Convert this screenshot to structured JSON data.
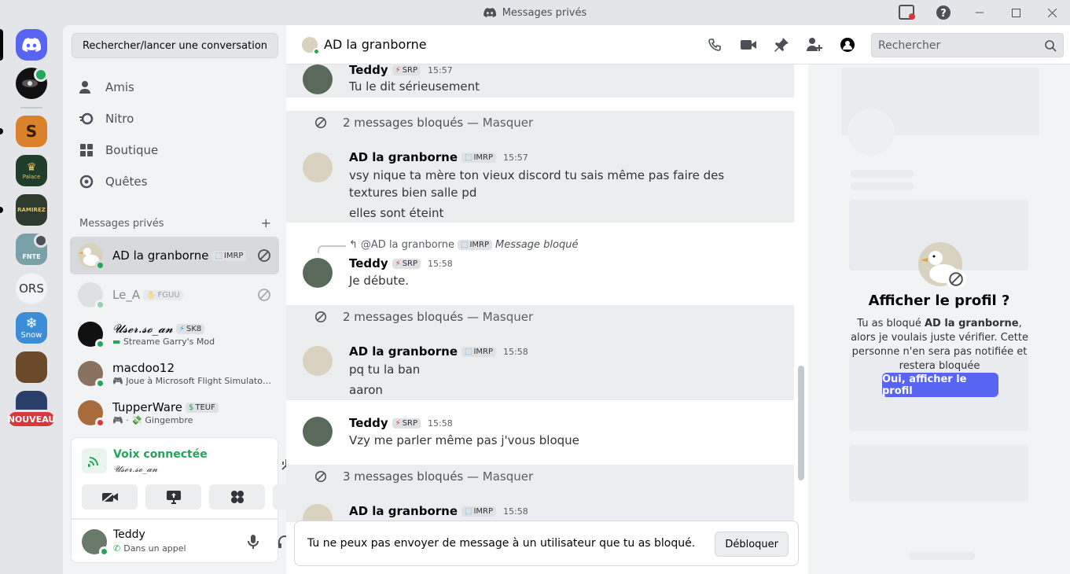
{
  "window": {
    "title": "Messages privés"
  },
  "servers": [
    {
      "name": "discord-home"
    },
    {
      "name": "eye-server"
    },
    {
      "name": "srp-server"
    },
    {
      "name": "palace-server",
      "label": "Palace"
    },
    {
      "name": "ramirez-server",
      "label": "RAMIREZ"
    },
    {
      "name": "fnte-server",
      "label": "FNTE"
    },
    {
      "name": "ors-server",
      "label": "ORS"
    },
    {
      "name": "snow-server",
      "label": "Snow"
    },
    {
      "name": "game-server-1"
    },
    {
      "name": "game-server-2"
    }
  ],
  "nouveau_badge": "NOUVEAU",
  "dm": {
    "search_label": "Rechercher/lancer une conversation",
    "nav": [
      {
        "label": "Amis",
        "icon": "friends-icon"
      },
      {
        "label": "Nitro",
        "icon": "nitro-icon"
      },
      {
        "label": "Boutique",
        "icon": "shop-icon"
      },
      {
        "label": "Quêtes",
        "icon": "quests-icon"
      }
    ],
    "section_title": "Messages privés",
    "conversations": [
      {
        "name": "AD la granborne",
        "tag": "IMRP"
      },
      {
        "name": "Le_A",
        "tag": "FGUU"
      },
      {
        "name": "𝓤𝓼𝓮𝓻.𝓼𝓸_𝓪𝓷",
        "tag": "SK8",
        "sub": "Streame Garry's Mod"
      },
      {
        "name": "macdoo12",
        "sub": "Joue à Microsoft Flight Simulato…"
      },
      {
        "name": "TupperWare",
        "tag": "TEUF",
        "sub": "· 💸 Gingembre"
      }
    ]
  },
  "voice": {
    "title": "Voix connectée",
    "channel": "𝓤𝓼𝓮𝓻.𝓼𝓸_𝓪𝓷"
  },
  "user": {
    "name": "Teddy",
    "status": "Dans un appel"
  },
  "chat": {
    "header_name": "AD la granborne",
    "search_placeholder": "Rechercher",
    "messages": {
      "m1": {
        "author": "Teddy",
        "tag": "SRP",
        "time": "15:57",
        "text": "Tu le dit sérieusement"
      },
      "b1": {
        "text": "2 messages bloqués —",
        "action": "Masquer"
      },
      "m2": {
        "author": "AD la granborne",
        "tag": "IMRP",
        "time": "15:57",
        "text1": "vsy nique ta mère ton vieux discord tu sais même pas faire des textures bien salle pd",
        "text2": "elles sont éteint"
      },
      "reply": {
        "author": "@AD la granborne",
        "tag": "IMRP",
        "note": "Message bloqué"
      },
      "m3": {
        "author": "Teddy",
        "tag": "SRP",
        "time": "15:58",
        "text": "Je débute."
      },
      "b2": {
        "text": "2 messages bloqués —",
        "action": "Masquer"
      },
      "m4": {
        "author": "AD la granborne",
        "tag": "IMRP",
        "time": "15:58",
        "text1": "pq tu la ban",
        "text2": "aaron"
      },
      "m5": {
        "author": "Teddy",
        "tag": "SRP",
        "time": "15:58",
        "text": "Vzy me parler même pas j'vous bloque"
      },
      "b3": {
        "text": "3 messages bloqués —",
        "action": "Masquer"
      },
      "m6": {
        "author": "AD la granborne",
        "tag": "IMRP",
        "time": "15:58"
      }
    },
    "footer_text": "Tu ne peux pas envoyer de message à un utilisateur que tu as bloqué.",
    "unblock_label": "Débloquer"
  },
  "profile": {
    "title": "Afficher le profil ?",
    "text_before": "Tu as bloqué ",
    "text_bold": "AD la granborne",
    "text_after": ", alors je voulais juste vérifier. Cette personne n'en sera pas notifiée et restera bloquée",
    "button": "Oui, afficher le profil"
  },
  "colors": {
    "accent": "#5865f2",
    "online": "#23a55a",
    "dnd": "#da373c"
  }
}
